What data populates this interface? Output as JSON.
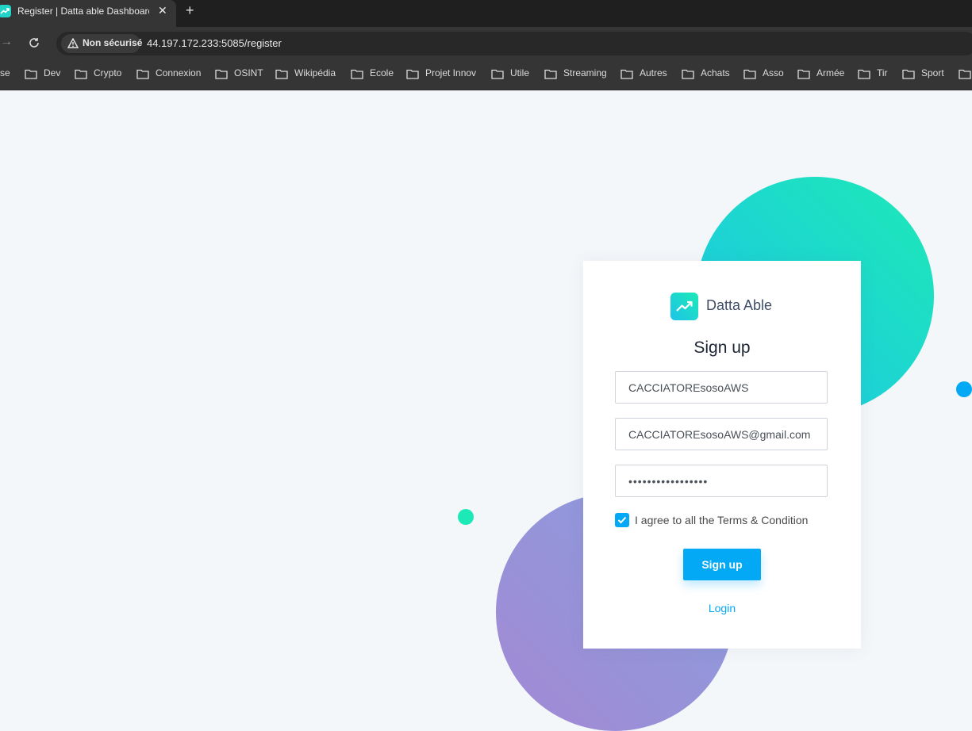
{
  "browser": {
    "tab_title": "Register | Datta able Dashboard",
    "tab_close": "✕",
    "new_tab": "+",
    "security_label": "Non sécurisé",
    "url": "44.197.172.233:5085/register",
    "bookmarks": [
      "se",
      "Dev",
      "Crypto",
      "Connexion",
      "OSINT",
      "Wikipédia",
      "Ecole",
      "Projet Innov",
      "Utile",
      "Streaming",
      "Autres",
      "Achats",
      "Asso",
      "Armée",
      "Tir",
      "Sport"
    ]
  },
  "card": {
    "brand_name": "Datta Able",
    "heading": "Sign up",
    "username_value": "CACCIATOREsosoAWS",
    "email_value": "CACCIATOREsosoAWS@gmail.com",
    "password_value": "•••••••••••••••••",
    "terms_label": "I agree to all the Terms & Condition",
    "terms_checked": true,
    "signup_label": "Sign up",
    "login_label": "Login"
  },
  "colors": {
    "primary": "#04a9f5",
    "teal": "#1de9b6",
    "purple": "#a389d4",
    "background": "#f4f7fa"
  }
}
